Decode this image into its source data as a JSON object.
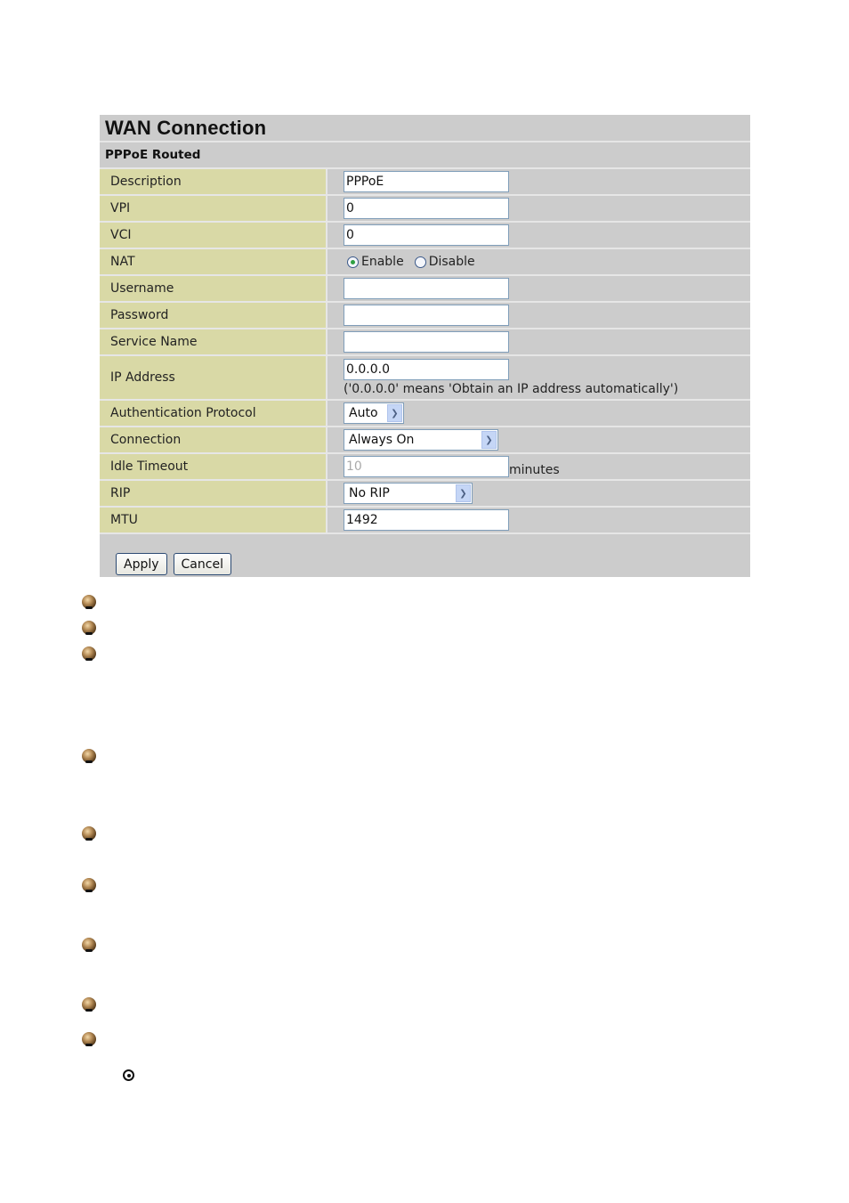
{
  "panel": {
    "title": "WAN Connection",
    "subtitle": "PPPoE Routed"
  },
  "fields": {
    "description": {
      "label": "Description",
      "value": "PPPoE"
    },
    "vpi": {
      "label": "VPI",
      "value": "0"
    },
    "vci": {
      "label": "VCI",
      "value": "0"
    },
    "nat": {
      "label": "NAT",
      "options": [
        "Enable",
        "Disable"
      ],
      "selected": "Enable"
    },
    "username": {
      "label": "Username",
      "value": ""
    },
    "password": {
      "label": "Password",
      "value": ""
    },
    "service_name": {
      "label": "Service Name",
      "value": ""
    },
    "ip_address": {
      "label": "IP Address",
      "value": "0.0.0.0",
      "hint": "('0.0.0.0' means 'Obtain an IP address automatically')"
    },
    "auth_protocol": {
      "label": "Authentication Protocol",
      "selected": "Auto"
    },
    "connection": {
      "label": "Connection",
      "selected": "Always On"
    },
    "idle_timeout": {
      "label": "Idle Timeout",
      "value": "10",
      "unit": "minutes",
      "disabled": true
    },
    "rip": {
      "label": "RIP",
      "selected": "No RIP"
    },
    "mtu": {
      "label": "MTU",
      "value": "1492"
    }
  },
  "buttons": {
    "apply": "Apply",
    "cancel": "Cancel"
  },
  "icons": {
    "bullet": "bullet-sphere-icon",
    "target": "radio-target-icon"
  }
}
